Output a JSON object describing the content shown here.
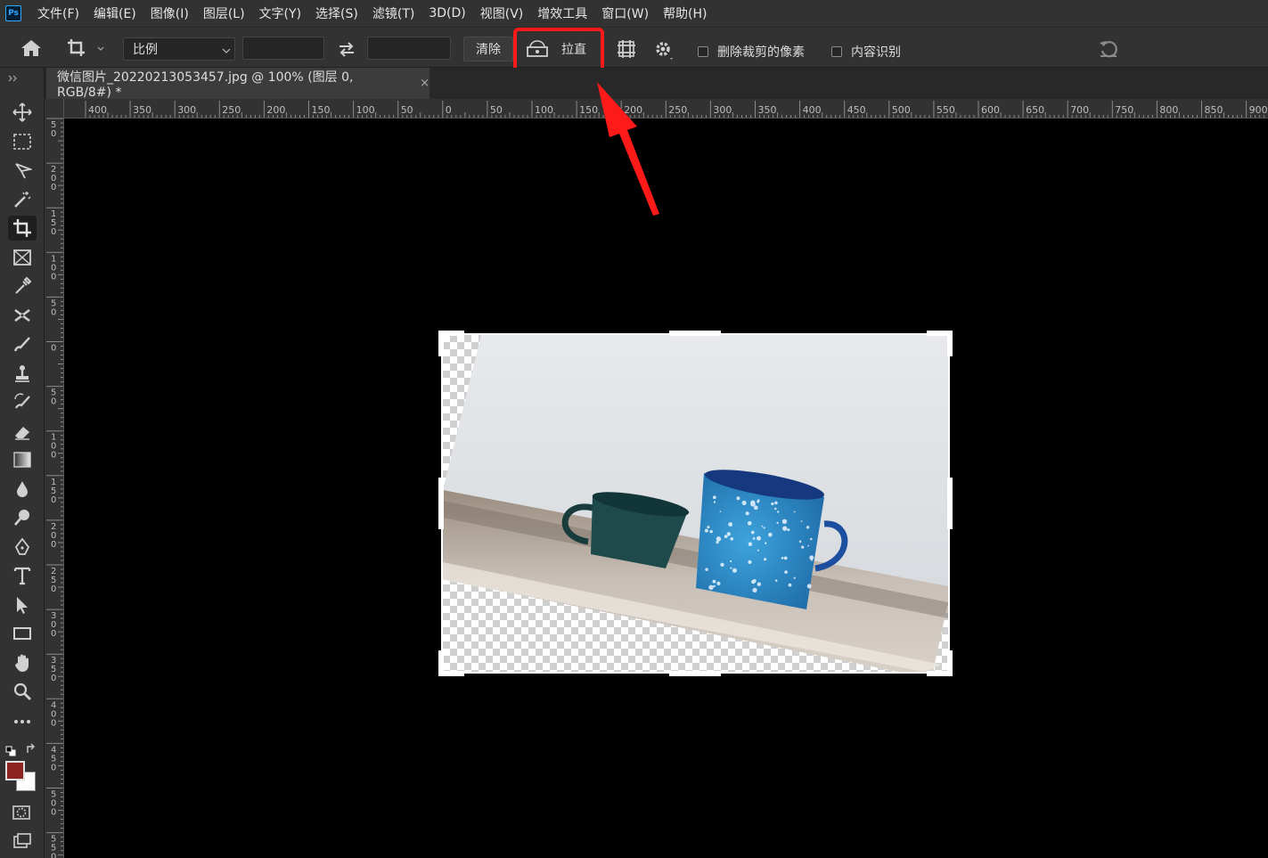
{
  "app": {
    "logo_text": "Ps"
  },
  "menu": [
    "文件(F)",
    "编辑(E)",
    "图像(I)",
    "图层(L)",
    "文字(Y)",
    "选择(S)",
    "滤镜(T)",
    "3D(D)",
    "视图(V)",
    "增效工具",
    "窗口(W)",
    "帮助(H)"
  ],
  "options": {
    "ratio_select": "比例",
    "width_value": "",
    "height_value": "",
    "clear_label": "清除",
    "straighten_label": "拉直",
    "delete_cropped_label": "删除裁剪的像素",
    "content_aware_label": "内容识别",
    "delete_cropped_checked": false,
    "content_aware_checked": false
  },
  "document": {
    "tab_title": "微信图片_20220213053457.jpg @ 100% (图层 0, RGB/8#) *",
    "close_glyph": "×"
  },
  "ruler_top": [
    "400",
    "350",
    "300",
    "250",
    "200",
    "150",
    "100",
    "50",
    "0",
    "50",
    "100",
    "150",
    "200",
    "250",
    "300",
    "350",
    "400",
    "450",
    "500",
    "550",
    "600",
    "650",
    "700",
    "750",
    "800",
    "850",
    "900"
  ],
  "ruler_left": [
    "5 0",
    "2 0 0",
    "1 5 0",
    "1 0 0",
    "5 0",
    "0",
    "5 0",
    "1 0 0",
    "1 5 0",
    "2 0 0",
    "2 5 0",
    "3 0 0",
    "3 5 0",
    "4 0 0",
    "4 5 0",
    "5 0 0",
    "5 5 0"
  ],
  "colors": {
    "foreground": "#8b2323",
    "background": "#ffffff",
    "highlight": "#ff1a1a",
    "arrow": "#ff1a1a"
  },
  "tools": [
    "move-icon",
    "marquee-icon",
    "lasso-icon",
    "magic-wand-icon",
    "crop-icon",
    "frame-icon",
    "eyedropper-icon",
    "healing-icon",
    "brush-icon",
    "stamp-icon",
    "history-brush-icon",
    "eraser-icon",
    "gradient-icon",
    "blur-icon",
    "dodge-icon",
    "pen-icon",
    "type-icon",
    "path-select-icon",
    "rectangle-icon",
    "hand-icon",
    "zoom-icon",
    "more-icon"
  ]
}
